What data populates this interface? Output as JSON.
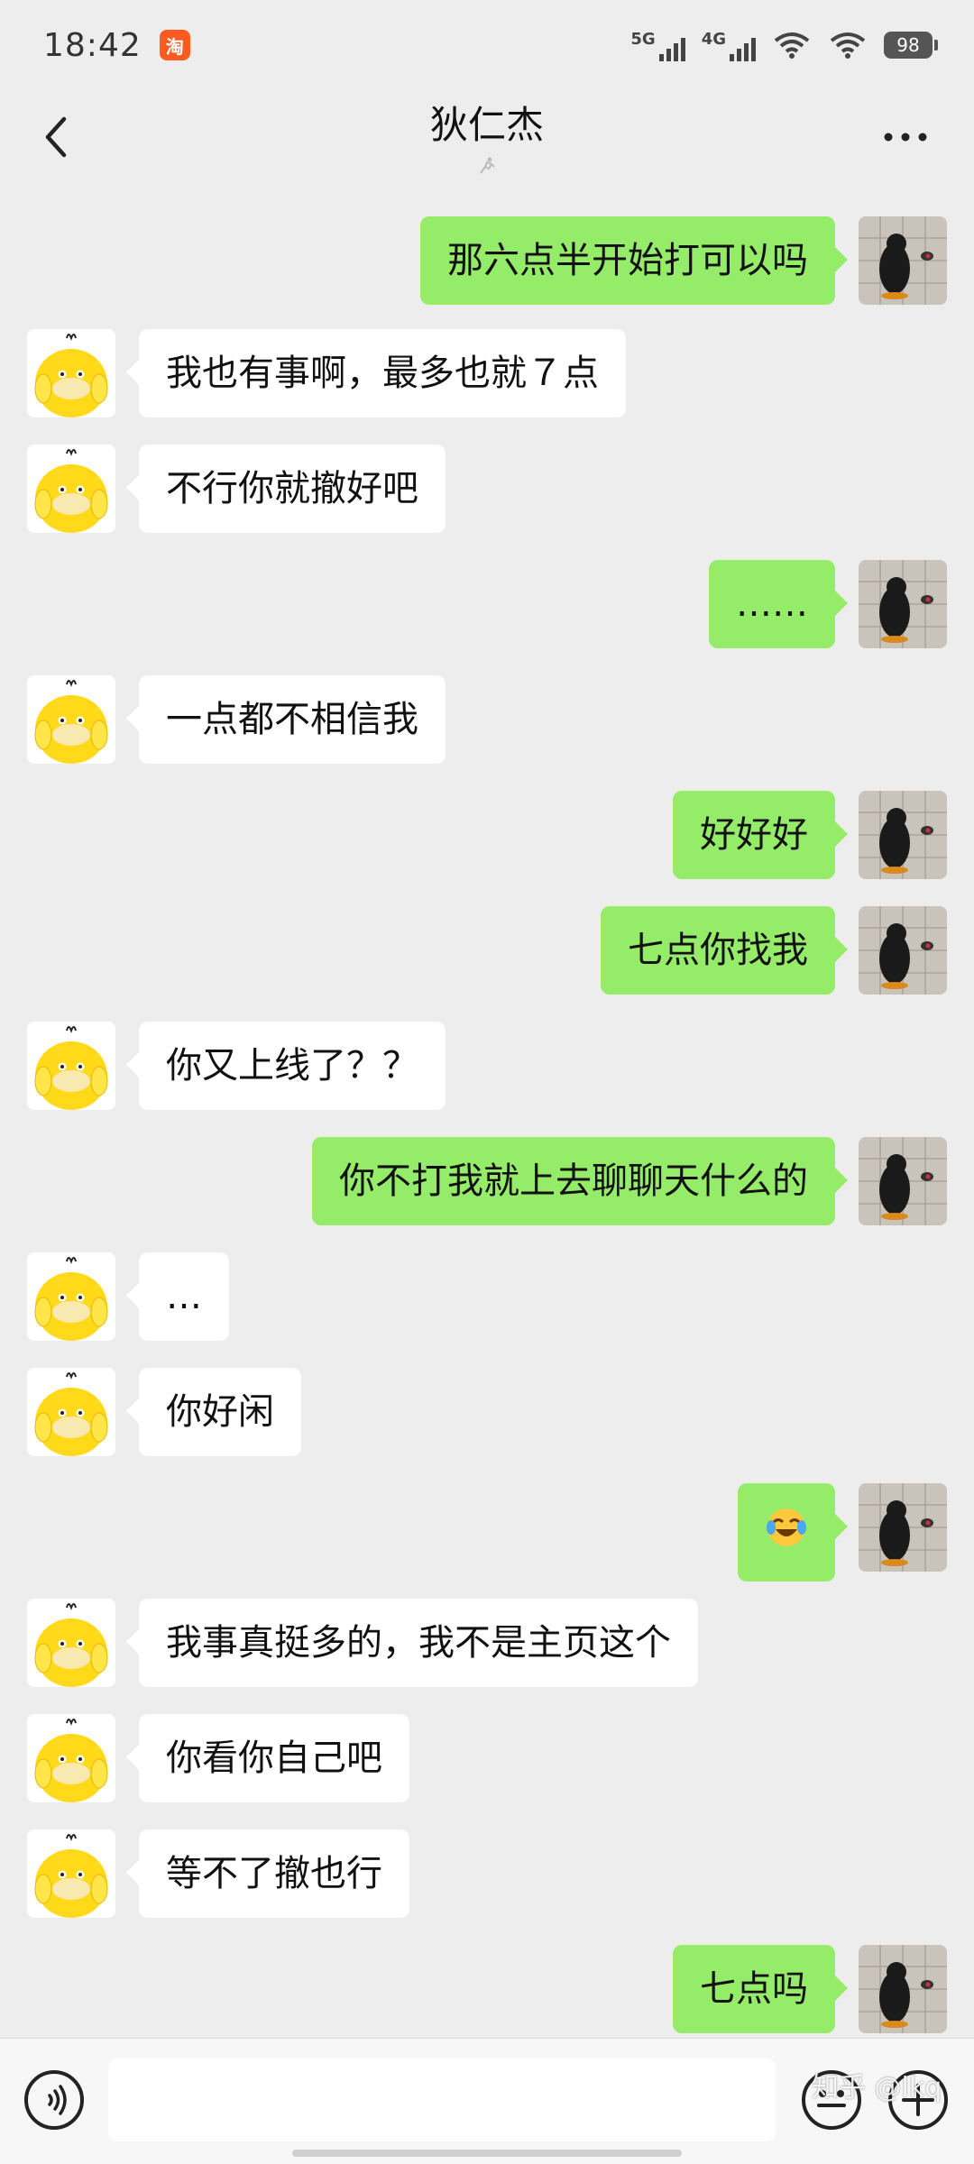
{
  "status_bar": {
    "time": "18:42",
    "network1": "5G",
    "network2": "4G",
    "battery": "98"
  },
  "header": {
    "title": "狄仁杰"
  },
  "messages": [
    {
      "side": "right",
      "text": "那六点半开始打可以吗"
    },
    {
      "side": "left",
      "text": "我也有事啊，最多也就７点"
    },
    {
      "side": "left",
      "text": "不行你就撤好吧"
    },
    {
      "side": "right",
      "text": "……"
    },
    {
      "side": "left",
      "text": "一点都不相信我"
    },
    {
      "side": "right",
      "text": "好好好"
    },
    {
      "side": "right",
      "text": "七点你找我"
    },
    {
      "side": "left",
      "text": "你又上线了？？"
    },
    {
      "side": "right",
      "text": "你不打我就上去聊聊天什么的"
    },
    {
      "side": "left",
      "text": "…"
    },
    {
      "side": "left",
      "text": "你好闲"
    },
    {
      "side": "right",
      "text": "",
      "emoji": "laughing-tears-emoji"
    },
    {
      "side": "left",
      "text": "我事真挺多的，我不是主页这个"
    },
    {
      "side": "left",
      "text": "你看你自己吧"
    },
    {
      "side": "left",
      "text": "等不了撤也行"
    },
    {
      "side": "right",
      "text": "七点吗"
    }
  ],
  "input": {
    "value": "",
    "watermark": "知乎 @lkq"
  },
  "colors": {
    "background": "#ededed",
    "sent_bubble": "#95ec69",
    "received_bubble": "#ffffff"
  }
}
